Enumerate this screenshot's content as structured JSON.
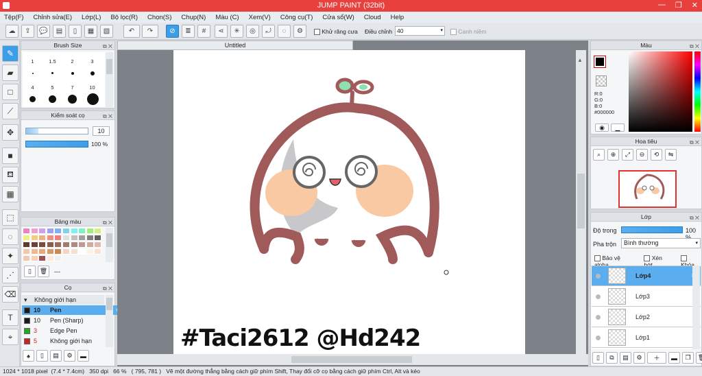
{
  "window": {
    "title": "JUMP PAINT (32bit)",
    "minimize": "—",
    "maximize": "❐",
    "close": "✕"
  },
  "menu": [
    "Tệp(F)",
    "Chỉnh sửa(E)",
    "Lớp(L)",
    "Bộ lọc(R)",
    "Chọn(S)",
    "Chụp(N)",
    "Màu (C)",
    "Xem(V)",
    "Công cụ(T)",
    "Cửa sổ(W)",
    "Cloud",
    "Help"
  ],
  "toolbar": {
    "antialias_label": "Khử răng cưa",
    "adjust_label": "Điều chỉnh",
    "adjust_value": "40",
    "snap_label": "Canh niềm"
  },
  "document": {
    "tab_title": "Untitled",
    "signature": "#Taci2612 @Hd242"
  },
  "brush_size": {
    "title": "Brush Size",
    "sizes": [
      "1",
      "1.5",
      "2",
      "3",
      "4",
      "5",
      "7",
      "10"
    ]
  },
  "brush_control": {
    "title": "Kiểm soát cọ",
    "size_value": "10",
    "opacity_value": "100 %"
  },
  "palette": {
    "title": "Bảng màu",
    "more_label": "---",
    "colors": [
      "#f080c0",
      "#f0a0d0",
      "#d0a0f0",
      "#a0a0f0",
      "#80b0f0",
      "#80d0f0",
      "#80f0f0",
      "#80f0c0",
      "#a0f080",
      "#d0f080",
      "#f0f080",
      "#f0d080",
      "#f0b080",
      "#f09080",
      "#f08080",
      "#e0e0e0",
      "#c0c0c0",
      "#a0a0a0",
      "#808080",
      "#606060",
      "#5c3a32",
      "#6a4038",
      "#7a4a40",
      "#8a5a50",
      "#9a6a60",
      "#a07a70",
      "#b08a80",
      "#c09a90",
      "#d0aaa0",
      "#e0bab0",
      "#f4c8a8",
      "#f0b890",
      "#e8a878",
      "#d89868",
      "#c88858",
      "#f6d4c0",
      "#f8e0d0",
      "#ffffff",
      "#fff0e8",
      "#ffe0d0",
      "#f0c8b0",
      "#f8d0b8",
      "#a05050",
      "#ffe8e0",
      "#f0f0f0"
    ]
  },
  "brushes": {
    "title": "Cọ",
    "category": "Không giới hạn",
    "items": [
      {
        "size": "10",
        "name": "Pen",
        "color": "#1a1a1a"
      },
      {
        "size": "10",
        "name": "Pen (Sharp)",
        "color": "#1a1a1a"
      },
      {
        "size": "3",
        "name": "Edge Pen",
        "color": "#22aa22"
      },
      {
        "size": "5",
        "name": "Không giới hạn",
        "color": "#cc2222"
      }
    ]
  },
  "color_panel": {
    "title": "Màu",
    "r": "R:0",
    "g": "G:0",
    "b": "B:0",
    "hex": "#000000"
  },
  "navigator": {
    "title": "Hoa tiêu"
  },
  "layers": {
    "title": "Lớp",
    "opacity_label": "Độ trong",
    "opacity_value": "100 %",
    "blend_label": "Pha trộn",
    "blend_value": "Bình thường",
    "protect_alpha": "Bảo vệ alpha",
    "clipping": "Xén bớt",
    "lock": "Khóa",
    "items": [
      "Lớp4",
      "Lớp3",
      "Lớp2",
      "Lớp1"
    ]
  },
  "status": {
    "size": "1024 * 1018 pixel",
    "cm": "(7.4 * 7.4cm)",
    "dpi": "350 dpi",
    "zoom": "66 %",
    "coords": "( 795, 781 )",
    "hint": "Vẽ một đường thẳng bằng cách giữ phím Shift, Thay đổi cỡ cọ bằng cách giữ phím Ctrl, Alt và kéo"
  },
  "colors": {
    "accent": "#3d9ee8",
    "titlebar": "#e8403c",
    "stroke": "#a05a5a",
    "cheek": "#f9c9a4",
    "sprout": "#8fe0b0"
  }
}
